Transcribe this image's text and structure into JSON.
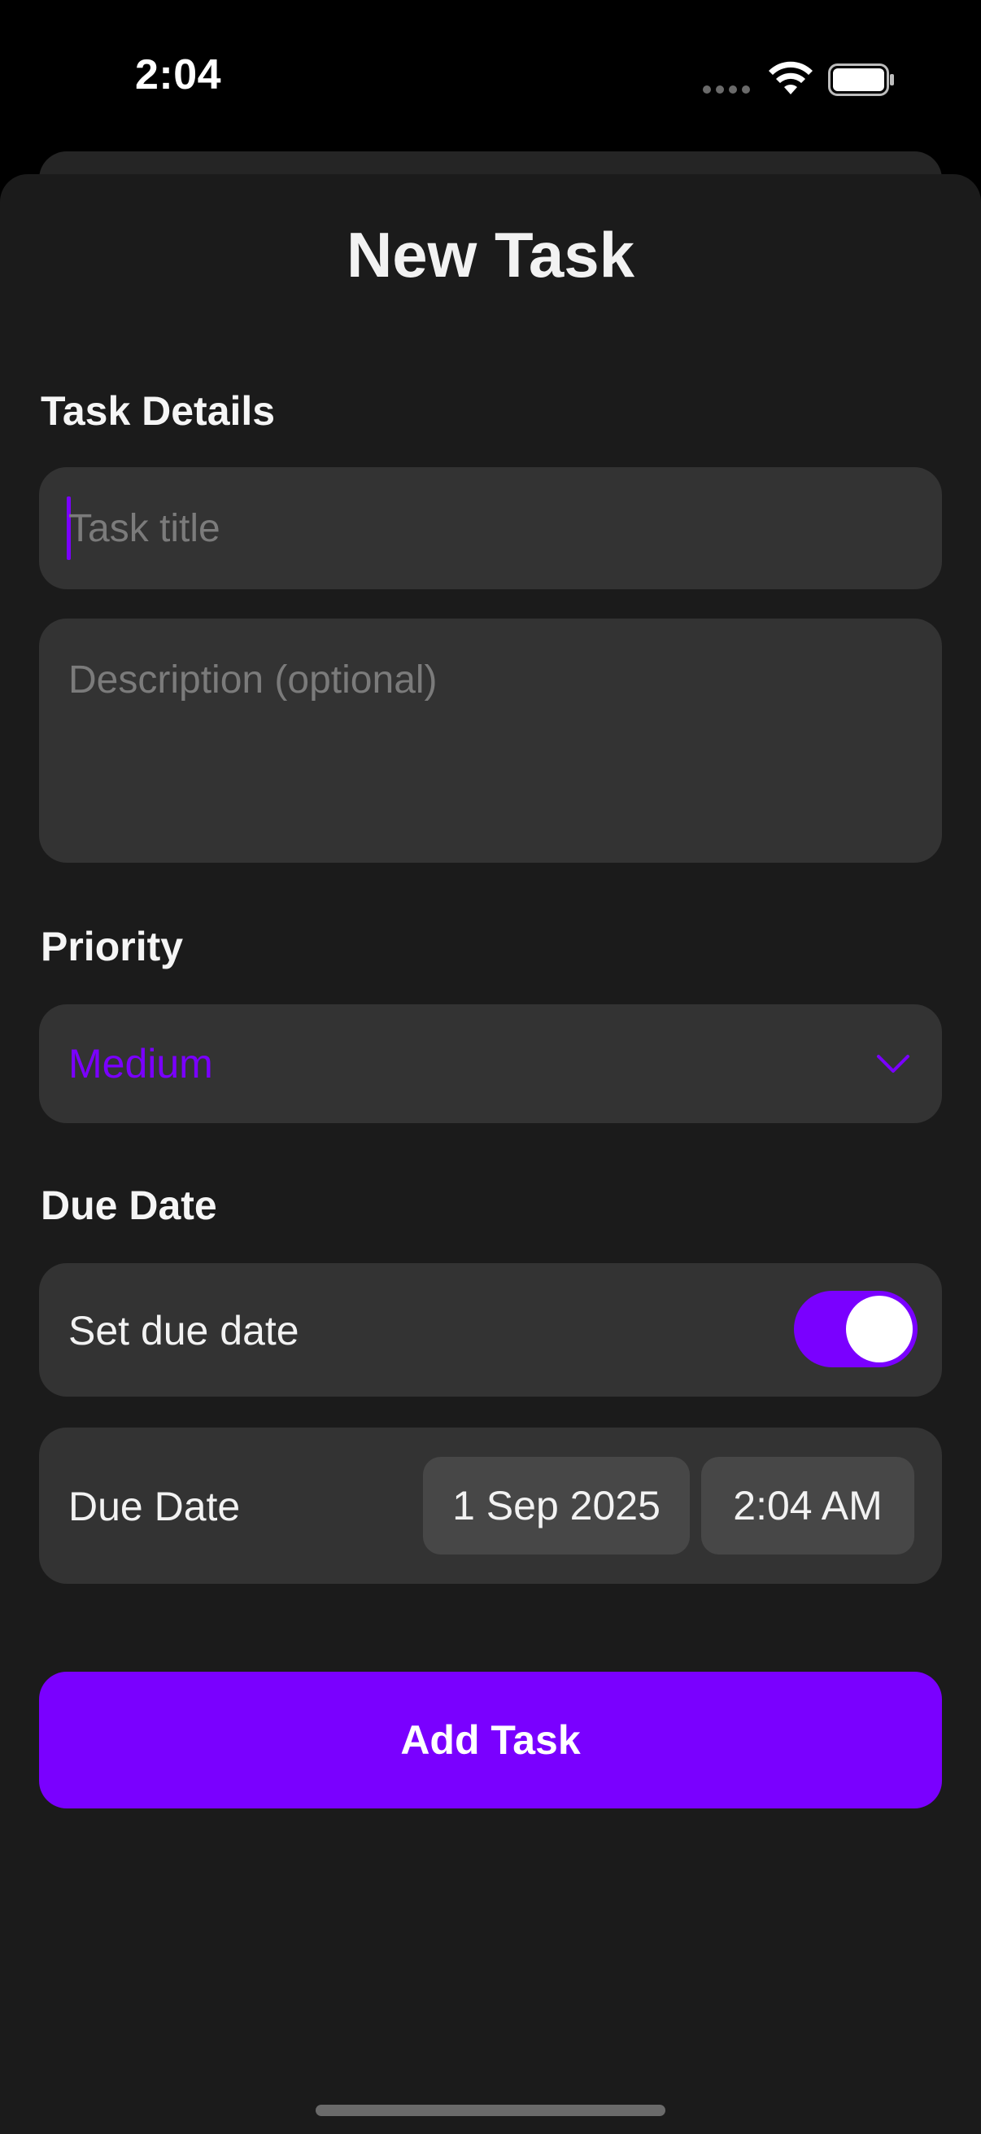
{
  "status_bar": {
    "time": "2:04"
  },
  "sheet": {
    "title": "New Task"
  },
  "task_details": {
    "label": "Task Details",
    "title_placeholder": "Task title",
    "description_placeholder": "Description (optional)"
  },
  "priority": {
    "label": "Priority",
    "selected": "Medium"
  },
  "due_date": {
    "section_label": "Due Date",
    "toggle_label": "Set due date",
    "toggle_on": true,
    "row_label": "Due Date",
    "date": "1 Sep 2025",
    "time": "2:04 AM"
  },
  "actions": {
    "add_label": "Add Task"
  },
  "colors": {
    "accent": "#7A00FF",
    "background": "#000000",
    "sheet": "#1B1B1B",
    "field": "#333333",
    "placeholder": "#7B7B7B"
  },
  "icons": [
    "wifi-icon",
    "battery-icon",
    "chevron-down-icon"
  ]
}
